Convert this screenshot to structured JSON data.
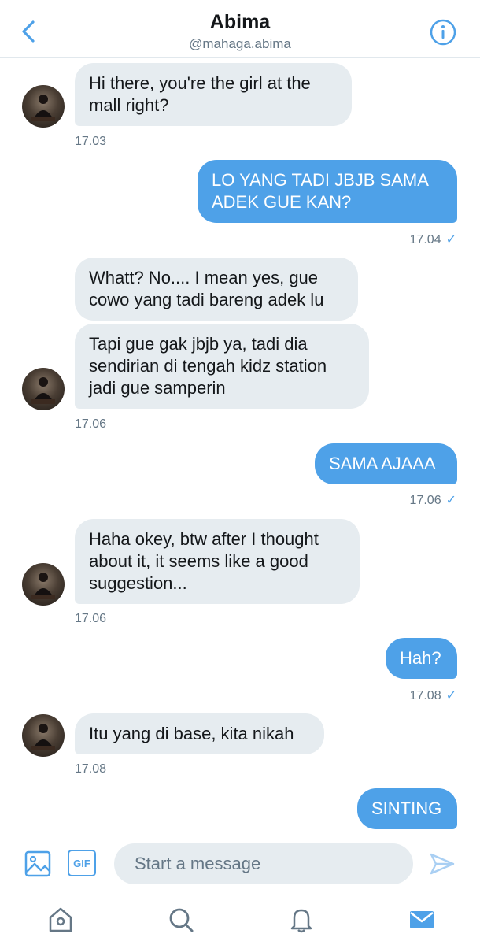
{
  "header": {
    "name": "Abima",
    "handle": "@mahaga.abima"
  },
  "messages": [
    {
      "from": "them",
      "text": "Hi there, you're the girl at the mall right?"
    },
    {
      "time": "17.03"
    },
    {
      "from": "me",
      "text": "LO YANG TADI JBJB SAMA ADEK GUE KAN?"
    },
    {
      "time": "17.04"
    },
    {
      "from": "them",
      "text": "Whatt? No.... I mean yes, gue cowo yang tadi bareng adek lu"
    },
    {
      "from": "them",
      "text": "Tapi gue gak jbjb ya, tadi dia sendirian di tengah kidz station jadi gue samperin"
    },
    {
      "time": "17.06"
    },
    {
      "from": "me",
      "text": "SAMA AJAAA"
    },
    {
      "time": "17.06"
    },
    {
      "from": "them",
      "text": "Haha okey, btw after I thought about it, it seems like a good suggestion..."
    },
    {
      "time": "17.06"
    },
    {
      "from": "me",
      "text": "Hah?"
    },
    {
      "time": "17.08"
    },
    {
      "from": "them",
      "text": "Itu yang di base, kita nikah"
    },
    {
      "time": "17.08"
    },
    {
      "from": "me",
      "text": "SINTING"
    }
  ],
  "composer": {
    "placeholder": "Start a message",
    "gif_label": "GIF"
  },
  "icons": {
    "back": "chevron-left-icon",
    "info": "info-icon",
    "image": "image-icon",
    "gif": "gif-icon",
    "send": "send-icon",
    "nav": [
      "home-icon",
      "search-icon",
      "bell-icon",
      "mail-icon"
    ]
  },
  "colors": {
    "accent": "#4ea1e8",
    "incoming_bubble": "#e6ecf0",
    "muted_text": "#657786"
  },
  "read_receipt": "✓"
}
